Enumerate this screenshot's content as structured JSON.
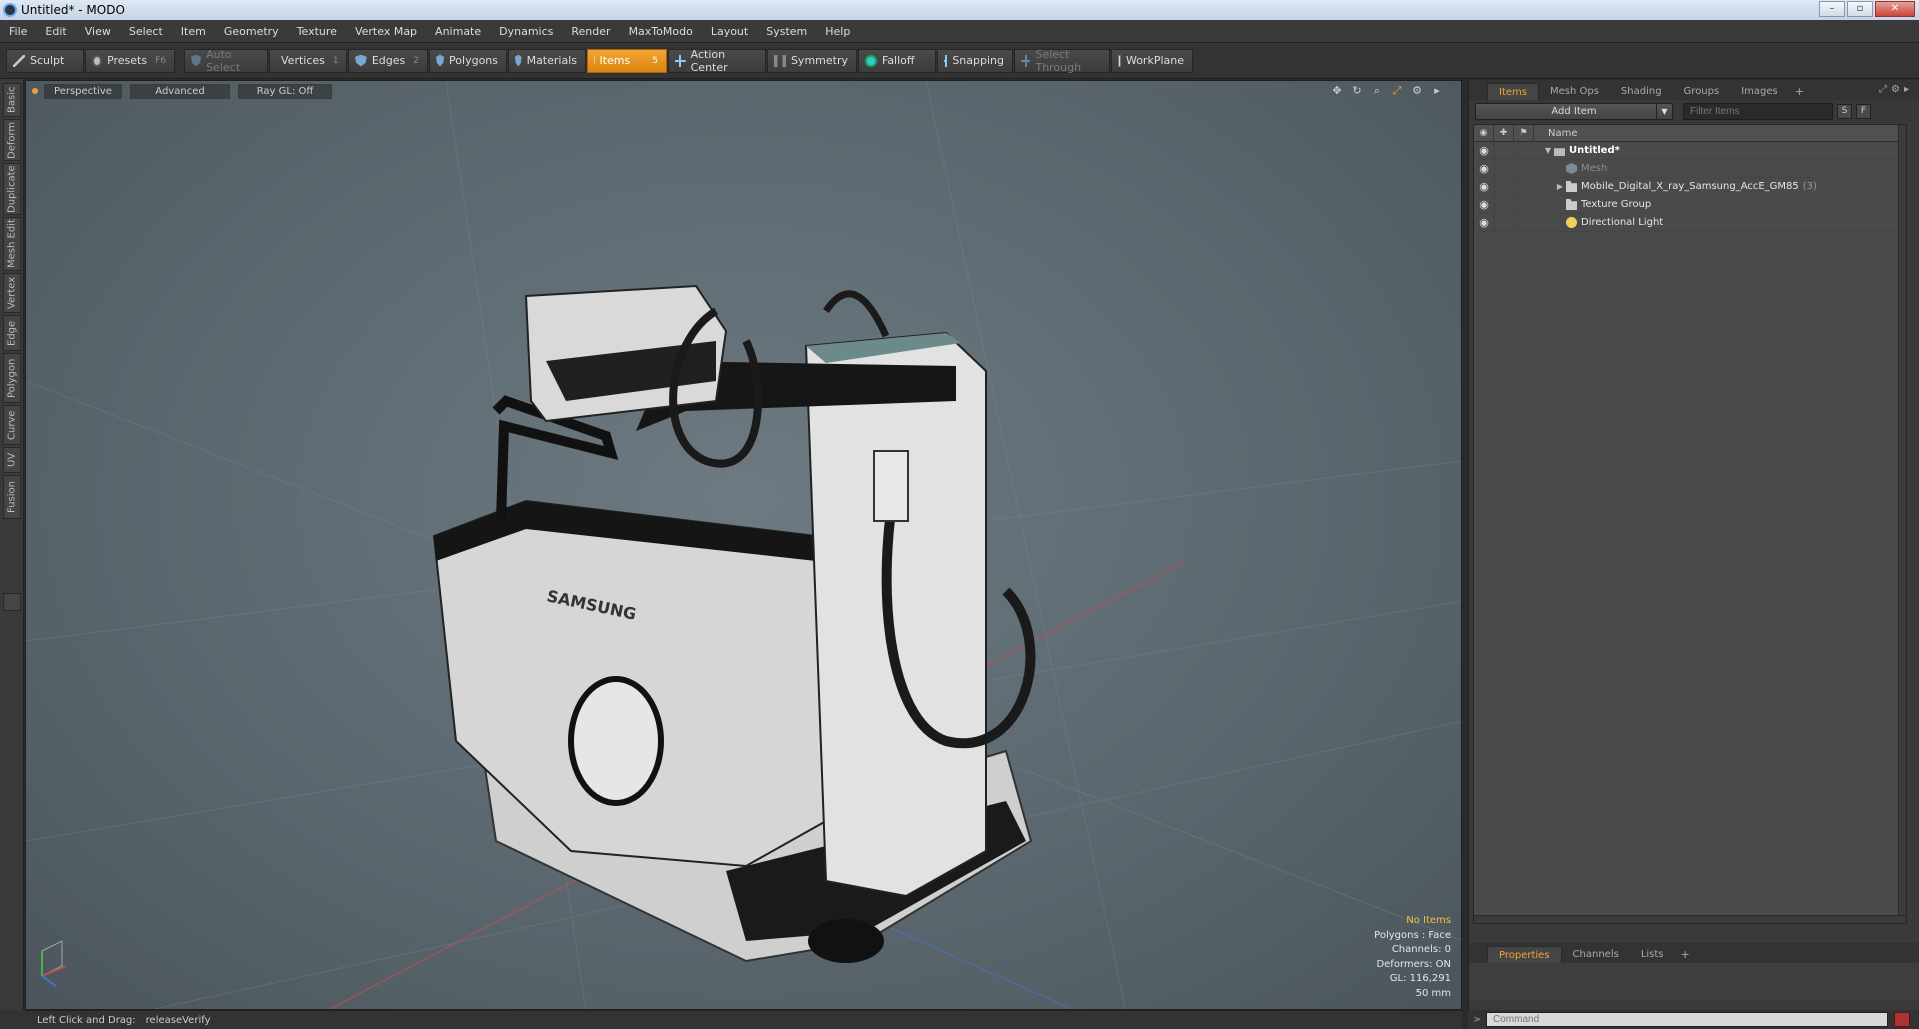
{
  "window": {
    "title": "Untitled* - MODO",
    "controls": [
      "–",
      "▫",
      "✕"
    ]
  },
  "menu": [
    "File",
    "Edit",
    "View",
    "Select",
    "Item",
    "Geometry",
    "Texture",
    "Vertex Map",
    "Animate",
    "Dynamics",
    "Render",
    "MaxToModo",
    "Layout",
    "System",
    "Help"
  ],
  "toolbar": {
    "sculpt": "Sculpt",
    "presets": "Presets",
    "presets_key": "F6",
    "auto_select": "Auto Select",
    "vertices": "Vertices",
    "vertices_key": "1",
    "edges": "Edges",
    "edges_key": "2",
    "polygons": "Polygons",
    "materials": "Materials",
    "items": "Items",
    "items_key": "5",
    "action_center": "Action Center",
    "symmetry": "Symmetry",
    "falloff": "Falloff",
    "snapping": "Snapping",
    "select_through": "Select Through",
    "workplane": "WorkPlane"
  },
  "left_tabs": [
    "Basic",
    "Deform",
    "Duplicate",
    "Mesh Edit",
    "Vertex",
    "Edge",
    "Polygon",
    "Curve",
    "UV",
    "Fusion"
  ],
  "viewport": {
    "view_mode": "Perspective",
    "shading": "Advanced",
    "raygl": "Ray GL: Off",
    "brand_text": "SAMSUNG",
    "info": {
      "selection": "No Items",
      "polygons": "Polygons : Face",
      "channels": "Channels: 0",
      "deformers": "Deformers: ON",
      "gl": "GL: 116,291",
      "scale": "50 mm"
    },
    "colors": {
      "background": "#5f6b72",
      "grid_x_axis": "#c0504d",
      "grid_z_axis": "#4a6fc0",
      "accent": "#f3a533"
    }
  },
  "items_panel": {
    "tabs": [
      "Items",
      "Mesh Ops",
      "Shading",
      "Groups",
      "Images"
    ],
    "add_item": "Add Item",
    "filter_placeholder": "Filter Items",
    "s_button": "S",
    "f_button": "F",
    "column_name": "Name",
    "tree": [
      {
        "label": "Untitled*",
        "depth": 0,
        "expanded": true,
        "type": "scene"
      },
      {
        "label": "Mesh",
        "depth": 1,
        "type": "mesh"
      },
      {
        "label": "Mobile_Digital_X_ray_Samsung_AccE_GM85",
        "count": "(3)",
        "depth": 1,
        "expandable": true,
        "type": "group"
      },
      {
        "label": "Texture Group",
        "depth": 1,
        "type": "group"
      },
      {
        "label": "Directional Light",
        "depth": 1,
        "type": "light"
      }
    ]
  },
  "properties_panel": {
    "tabs": [
      "Properties",
      "Channels",
      "Lists"
    ]
  },
  "status": {
    "hint": "Left Click and Drag:",
    "action": "releaseVerify"
  },
  "command": {
    "placeholder": "Command"
  }
}
